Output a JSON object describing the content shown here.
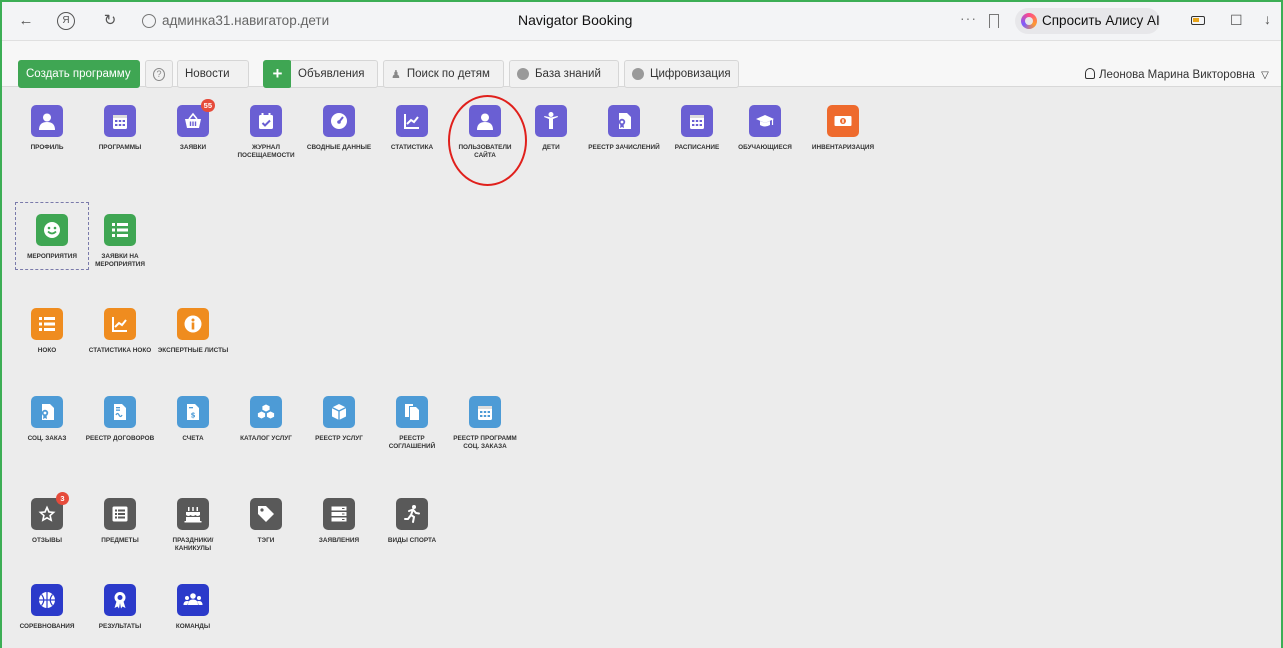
{
  "browser": {
    "address": "админка31.навигатор.дети",
    "page_title": "Navigator Booking",
    "alisa_label": "Спросить Алису AI",
    "nav_back": "←",
    "nav_yandex": "Я",
    "nav_reload": "↻",
    "dots": "···",
    "download": "↓",
    "ext": "☐"
  },
  "toolbar": {
    "create_label": "Создать программу",
    "help_label": "?",
    "news_label": "Новости",
    "plus_label": "+",
    "announcements_label": "Объявления",
    "search_children_label": "Поиск по детям",
    "knowledge_label": "База знаний",
    "digital_label": "Цифровизация",
    "user_name": "Леонова Марина Викторовна",
    "user_caret": "▽"
  },
  "tiles": {
    "profile": "ПРОФИЛЬ",
    "programs": "ПРОГРАММЫ",
    "requests": "ЗАЯВКИ",
    "requests_badge": "55",
    "attendance": "ЖУРНАЛ ПОСЕЩАЕМОСТИ",
    "summary": "СВОДНЫЕ ДАННЫЕ",
    "statistics": "СТАТИСТИКА",
    "site_users": "ПОЛЬЗОВАТЕЛИ САЙТА",
    "children": "ДЕТИ",
    "enrollment_registry": "РЕЕСТР ЗАЧИСЛЕНИЙ",
    "schedule": "РАСПИСАНИЕ",
    "students": "ОБУЧАЮЩИЕСЯ",
    "inventory": "ИНВЕНТАРИЗАЦИЯ",
    "events": "МЕРОПРИЯТИЯ",
    "event_requests": "ЗАЯВКИ НА МЕРОПРИЯТИЯ",
    "noko": "НОКО",
    "noko_stats": "СТАТИСТИКА НОКО",
    "expert_sheets": "ЭКСПЕРТНЫЕ ЛИСТЫ",
    "social_order": "СОЦ. ЗАКАЗ",
    "contracts_registry": "РЕЕСТР ДОГОВОРОВ",
    "invoices": "СЧЕТА",
    "services_catalog": "КАТАЛОГ УСЛУГ",
    "services_registry": "РЕЕСТР УСЛУГ",
    "agreements_registry": "РЕЕСТР СОГЛАШЕНИЙ",
    "social_programs_registry": "РЕЕСТР ПРОГРАММ СОЦ. ЗАКАЗА",
    "reviews": "ОТЗЫВЫ",
    "reviews_badge": "3",
    "subjects": "ПРЕДМЕТЫ",
    "holidays": "ПРАЗДНИКИ/ КАНИКУЛЫ",
    "tags": "ТЭГИ",
    "applications": "ЗАЯВЛЕНИЯ",
    "sports": "ВИДЫ СПОРТА",
    "competitions": "СОРЕВНОВАНИЯ",
    "results": "РЕЗУЛЬТАТЫ",
    "teams": "КОМАНДЫ"
  }
}
